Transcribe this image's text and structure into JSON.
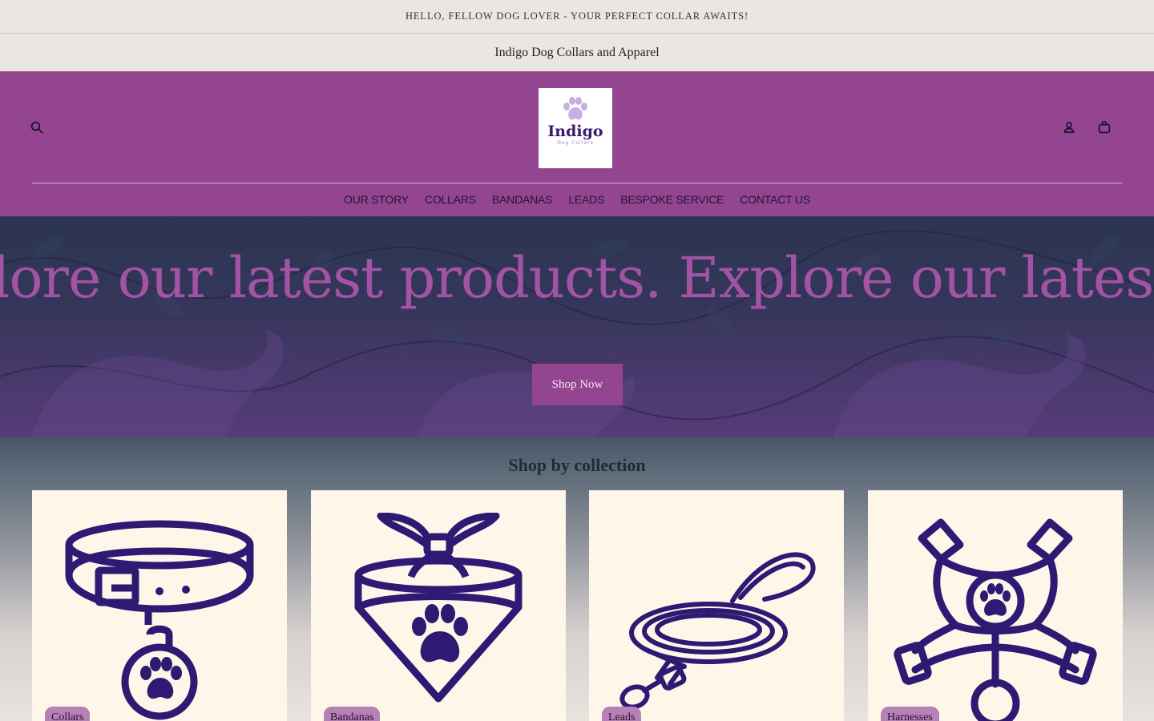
{
  "announcement": "HELLO, FELLOW DOG LOVER - YOUR PERFECT COLLAR AWAITS!",
  "subtitle": "Indigo Dog Collars and Apparel",
  "header": {
    "logo": {
      "word": "Indigo",
      "sub": "Dog Collars"
    },
    "icons": {
      "search": "search-icon",
      "account": "account-icon",
      "cart": "bag-icon"
    },
    "nav": [
      "OUR STORY",
      "COLLARS",
      "BANDANAS",
      "LEADS",
      "BESPOKE SERVICE",
      "CONTACT US"
    ]
  },
  "hero": {
    "marquee": "lore our latest products. Explore our latest prod",
    "button": "Shop Now"
  },
  "collections": {
    "title": "Shop by collection",
    "items": [
      {
        "label": "Collars",
        "icon": "collar-icon"
      },
      {
        "label": "Bandanas",
        "icon": "bandana-icon"
      },
      {
        "label": "Leads",
        "icon": "lead-icon"
      },
      {
        "label": "Harnesses",
        "icon": "harness-icon"
      }
    ]
  },
  "colors": {
    "brand": "#944590",
    "icon_purple": "#2e1a73",
    "card_bg": "#fdf6e9",
    "pill": "#b682b5"
  }
}
